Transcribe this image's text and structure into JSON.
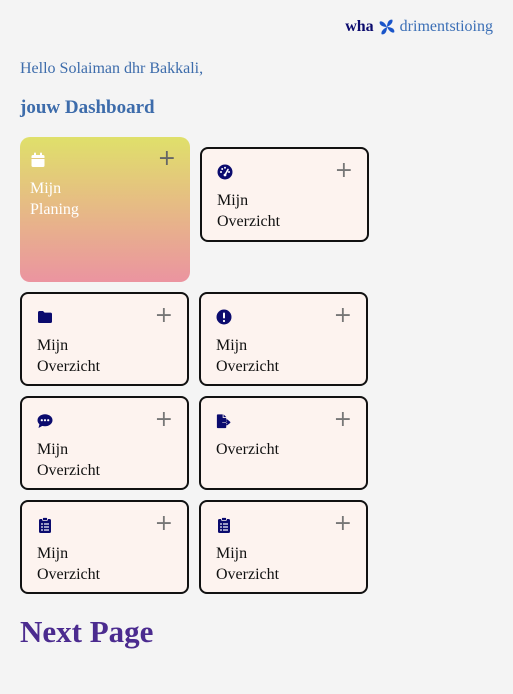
{
  "brand": {
    "strong": "wha",
    "rest": "drimentstioing"
  },
  "greeting": "Hello Solaiman dhr Bakkali,",
  "dashboard_title": "jouw Dashboard",
  "cards": [
    {
      "icon": "calendar-icon",
      "line1": "Mijn",
      "line2": "Planing",
      "plus": "+"
    },
    {
      "icon": "dashboard-gauge-icon",
      "line1": "Mijn",
      "line2": "Overzicht",
      "plus": "+"
    },
    {
      "icon": "folder-icon",
      "line1": "Mijn",
      "line2": "Overzicht",
      "plus": "+"
    },
    {
      "icon": "exclamation-circle-icon",
      "line1": "Mijn",
      "line2": "Overzicht",
      "plus": "+"
    },
    {
      "icon": "chat-bubble-icon",
      "line1": "Mijn",
      "line2": "Overzicht",
      "plus": "+"
    },
    {
      "icon": "file-export-icon",
      "line1": "Overzicht",
      "line2": "",
      "plus": "+"
    },
    {
      "icon": "clipboard-list-icon",
      "line1": "Mijn",
      "line2": "Overzicht",
      "plus": "+"
    },
    {
      "icon": "clipboard-list-icon",
      "line1": "Mijn",
      "line2": "Overzicht",
      "plus": "+"
    }
  ],
  "next_page": "Next Page",
  "colors": {
    "icon": "#0b0b6e",
    "accent_text": "#3d6cab",
    "next_page": "#4b2b8f",
    "card_bg": "#fdf3ef"
  }
}
